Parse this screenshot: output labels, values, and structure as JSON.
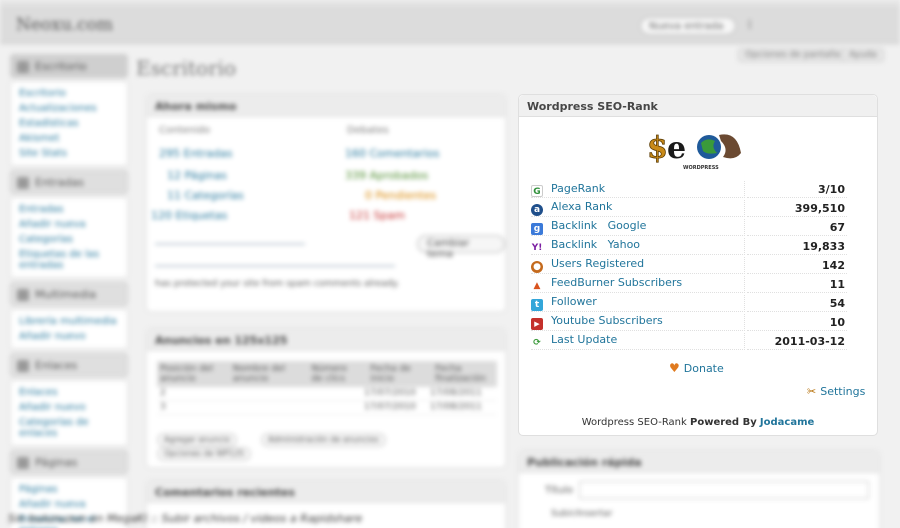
{
  "seo_widget": {
    "title": "Wordpress SEO-Rank",
    "logo_text": "SEO",
    "logo_subtext": "WORDPRESS",
    "rows": [
      {
        "label": "PageRank",
        "value": "3/10",
        "icon": "google-icon",
        "color": "#2f8f3a"
      },
      {
        "label": "Alexa Rank",
        "value": "399,510",
        "icon": "alexa-icon",
        "color": "#1f4f8b"
      },
      {
        "label": "Backlink   Google",
        "value": "67",
        "icon": "google-g-icon",
        "color": "#3b7ad9"
      },
      {
        "label": "Backlink   Yahoo",
        "value": "19,833",
        "icon": "yahoo-icon",
        "color": "#7b1fa2"
      },
      {
        "label": "Users Registered",
        "value": "142",
        "icon": "user-icon",
        "color": "#c46a1d"
      },
      {
        "label": "FeedBurner Subscribers",
        "value": "11",
        "icon": "feedburner-icon",
        "color": "#d9531e"
      },
      {
        "label": "Follower",
        "value": "54",
        "icon": "twitter-icon",
        "color": "#33a6d9"
      },
      {
        "label": "Youtube Subscribers",
        "value": "10",
        "icon": "youtube-icon",
        "color": "#c4302b"
      },
      {
        "label": "Last Update",
        "value": "2011-03-12",
        "icon": "update-icon",
        "color": "#3c9a3c"
      }
    ],
    "donate_label": "Donate",
    "settings_label": "Settings",
    "powered_prefix": "Wordpress SEO-Rank",
    "powered_by": "Powered By",
    "powered_link": "Jodacame"
  },
  "background": {
    "site_name": "Neoxu.com",
    "new_post": "Nueva entrada",
    "screen_options": "Opciones de pantalla",
    "help": "Ayuda",
    "page_title": "Escritorio",
    "right_now_title": "Ahora mismo",
    "right_now_col1": "Contenido",
    "right_now_col2": "Debates",
    "right_now_rows": [
      {
        "count": "295",
        "label": "Entradas",
        "count2": "160",
        "label2": "Comentarios"
      },
      {
        "count": "12",
        "label": "Páginas",
        "count2": "339",
        "label2": "Aprobados"
      },
      {
        "count": "11",
        "label": "Categorías",
        "count2": "0",
        "label2": "Pendientes"
      },
      {
        "count": "120",
        "label": "Etiquetas",
        "count2": "121",
        "label2": "Spam"
      }
    ],
    "theme_button": "Cambiar tema",
    "akismet_text": "has protected your site from spam comments already.",
    "ads_title": "Anuncios en 125x125",
    "ads_headers": [
      "Posición del anuncio",
      "Nombre del anuncio",
      "Número de clics",
      "Fecha de inicio",
      "Fecha finalización"
    ],
    "ads_rows": [
      {
        "pos": "2",
        "start": "17/07/2010",
        "end": "17/08/2011"
      },
      {
        "pos": "3",
        "start": "17/07/2010",
        "end": "17/08/2011"
      }
    ],
    "ads_buttons": [
      "Agregar anuncio",
      "Administración de anuncios",
      "Opciones de WP125"
    ],
    "comments_title": "Comentarios recientes",
    "quick_title": "Publicación rápida",
    "quick_label": "Título",
    "quick_upload": "Subir/Insertar",
    "bottom_text": "Sin bulunuzun en MegaKl :: Subir archivos / videos a Rapidshare",
    "sidebar": [
      {
        "head": "Escritorio",
        "items": [
          "Escritorio",
          "Actualizaciones",
          "Estadísticas",
          "Akismet",
          "Site Stats"
        ]
      },
      {
        "head": "Entradas",
        "items": [
          "Entradas",
          "Añadir nueva",
          "Categorías",
          "Etiquetas de las entradas"
        ]
      },
      {
        "head": "Multimedia",
        "items": [
          "Librería multimedia",
          "Añadir nuevo"
        ]
      },
      {
        "head": "Enlaces",
        "items": [
          "Enlaces",
          "Añadir nuevo",
          "Categorías de enlaces"
        ]
      },
      {
        "head": "Páginas",
        "items": [
          "Páginas",
          "Añadir nueva",
          "Encontrar en el entorno"
        ]
      }
    ]
  }
}
